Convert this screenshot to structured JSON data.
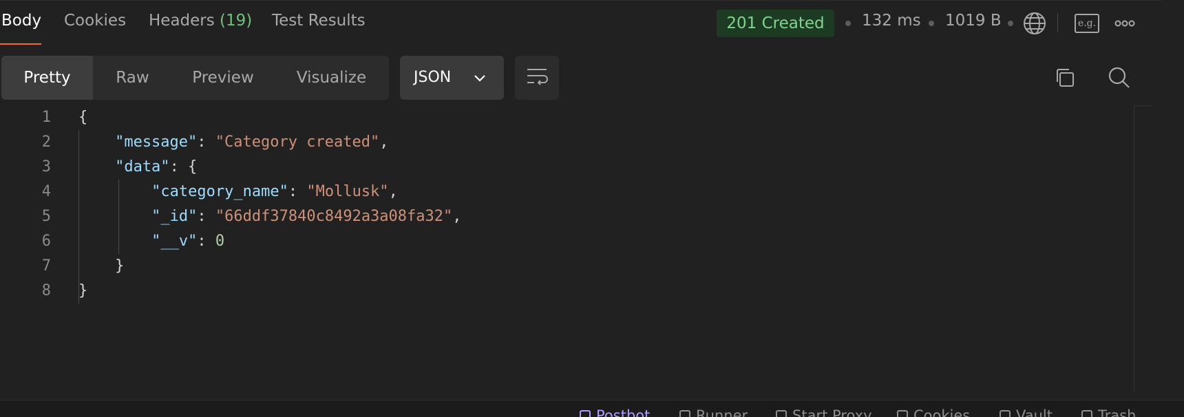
{
  "response_tabs": [
    {
      "label": "Body",
      "active": true
    },
    {
      "label": "Cookies"
    },
    {
      "label": "Headers ",
      "count": "(19)"
    },
    {
      "label": "Test Results"
    }
  ],
  "status": {
    "code_text": "201 Created",
    "time": "132 ms",
    "size": "1019 B",
    "color": "#7fd58b"
  },
  "icons": {
    "network": "globe-icon",
    "example": "e.g.",
    "more": "more-horizontal-icon",
    "copy": "copy-icon",
    "search": "search-icon",
    "wrap": "wrap-lines-icon"
  },
  "view_modes": [
    {
      "label": "Pretty",
      "active": true
    },
    {
      "label": "Raw"
    },
    {
      "label": "Preview"
    },
    {
      "label": "Visualize"
    }
  ],
  "format_select": {
    "value": "JSON"
  },
  "body_lines": [
    {
      "n": "1",
      "indent": 0,
      "tokens": [
        {
          "t": "{",
          "c": "p"
        }
      ]
    },
    {
      "n": "2",
      "indent": 1,
      "tokens": [
        {
          "t": "\"message\"",
          "c": "k"
        },
        {
          "t": ": ",
          "c": "p"
        },
        {
          "t": "\"Category created\"",
          "c": "s"
        },
        {
          "t": ",",
          "c": "p"
        }
      ]
    },
    {
      "n": "3",
      "indent": 1,
      "tokens": [
        {
          "t": "\"data\"",
          "c": "k"
        },
        {
          "t": ": {",
          "c": "p"
        }
      ]
    },
    {
      "n": "4",
      "indent": 2,
      "tokens": [
        {
          "t": "\"category_name\"",
          "c": "k"
        },
        {
          "t": ": ",
          "c": "p"
        },
        {
          "t": "\"Mollusk\"",
          "c": "s"
        },
        {
          "t": ",",
          "c": "p"
        }
      ]
    },
    {
      "n": "5",
      "indent": 2,
      "tokens": [
        {
          "t": "\"_id\"",
          "c": "k"
        },
        {
          "t": ": ",
          "c": "p"
        },
        {
          "t": "\"66ddf37840c8492a3a08fa32\"",
          "c": "s"
        },
        {
          "t": ",",
          "c": "p"
        }
      ]
    },
    {
      "n": "6",
      "indent": 2,
      "tokens": [
        {
          "t": "\"__v\"",
          "c": "k"
        },
        {
          "t": ": ",
          "c": "p"
        },
        {
          "t": "0",
          "c": "n"
        }
      ]
    },
    {
      "n": "7",
      "indent": 1,
      "tokens": [
        {
          "t": "}",
          "c": "p"
        }
      ]
    },
    {
      "n": "8",
      "indent": 0,
      "tokens": [
        {
          "t": "}",
          "c": "p"
        }
      ]
    }
  ],
  "bottom_bar": [
    {
      "label": "Postbot",
      "icon": "postbot-icon",
      "accent": true
    },
    {
      "label": "Runner",
      "icon": "runner-icon"
    },
    {
      "label": "Start Proxy",
      "icon": "proxy-icon"
    },
    {
      "label": "Cookies",
      "icon": "cookie-icon"
    },
    {
      "label": "Vault",
      "icon": "vault-icon"
    },
    {
      "label": "Trash",
      "icon": "trash-icon"
    }
  ]
}
